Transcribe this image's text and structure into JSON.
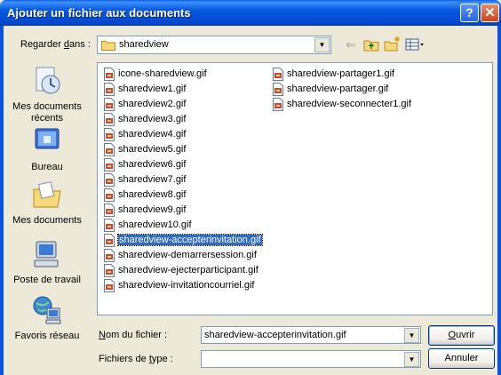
{
  "window": {
    "title": "Ajouter un fichier aux documents",
    "help_label": "?",
    "close_label": "✕"
  },
  "lookin": {
    "label_pre": "Regarder ",
    "label_accel": "d",
    "label_post": "ans :",
    "value": "sharedview"
  },
  "places": [
    {
      "label_lines": [
        "Mes documents",
        "récents"
      ],
      "icon": "recent-documents-icon"
    },
    {
      "label_lines": [
        "Bureau"
      ],
      "icon": "desktop-icon"
    },
    {
      "label_lines": [
        "Mes documents"
      ],
      "icon": "my-documents-icon"
    },
    {
      "label_lines": [
        "Poste de travail"
      ],
      "icon": "my-computer-icon"
    },
    {
      "label_lines": [
        "Favoris réseau"
      ],
      "icon": "network-places-icon"
    }
  ],
  "files_col1": [
    "icone-sharedview.gif",
    "sharedview1.gif",
    "sharedview2.gif",
    "sharedview3.gif",
    "sharedview4.gif",
    "sharedview5.gif",
    "sharedview6.gif",
    "sharedview7.gif",
    "sharedview8.gif",
    "sharedview9.gif",
    "sharedview10.gif",
    "sharedview-accepterinvitation.gif",
    "sharedview-demarrersession.gif",
    "sharedview-ejecterparticipant.gif",
    "sharedview-invitationcourriel.gif"
  ],
  "files_col2": [
    "sharedview-partager1.gif",
    "sharedview-partager.gif",
    "sharedview-seconnecter1.gif"
  ],
  "selected_file": "sharedview-accepterinvitation.gif",
  "filename": {
    "label_accel": "N",
    "label_rest": "om du fichier :",
    "value": "sharedview-accepterinvitation.gif"
  },
  "filetype": {
    "label_pre": "Fichiers de ",
    "label_accel": "t",
    "label_post": "ype :",
    "value": ""
  },
  "buttons": {
    "open_accel": "O",
    "open_rest": "uvrir",
    "cancel": "Annuler"
  },
  "colors": {
    "titlebar": "#0a52d9",
    "selection": "#316ac5",
    "face": "#ece9d8"
  }
}
